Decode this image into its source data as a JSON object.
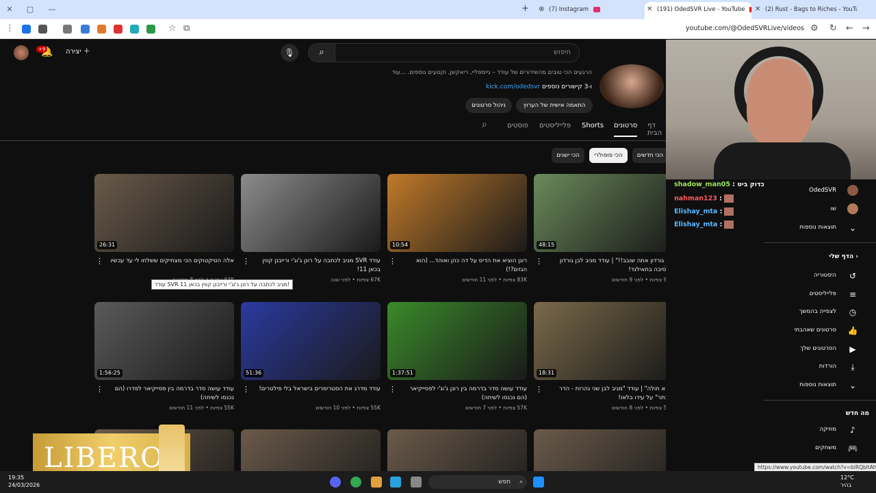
{
  "browser": {
    "tabs": [
      {
        "label": "(7) Instagram",
        "icon_color": "#e1306c"
      },
      {
        "label": "(191) OdedSVR Live - YouTube",
        "icon_color": "#ff0000"
      },
      {
        "label": "(2) Rust - Bags to Riches - YouTu",
        "icon_color": "#ff0000"
      }
    ],
    "url": "youtube.com/@OdedSVRLive/videos"
  },
  "header": {
    "notif_count": "+9",
    "create_label": "יצירה",
    "search_placeholder": "חיפוש"
  },
  "channel": {
    "description": "הרגעים הכי טובים מהשידורים של עודד – גיימפליי, ריאקשן, וקטעים נוספים. ...עוד",
    "link_text": "kick.com/odedsvr",
    "link_suffix": "ו-3 קישורים נוספים",
    "customize_button": "התאמה אישית של הערוץ",
    "manage_button": "ניהול סרטונים"
  },
  "channel_tabs": [
    "דף הבית",
    "סרטונים",
    "Shorts",
    "פלייליסטים",
    "פוסטים"
  ],
  "sort_chips": [
    "הכי חדשים",
    "הכי פופולרי",
    "הכי ישנים"
  ],
  "videos": [
    {
      "title": "\"בן גורדון אתה שובב!!\" | עודד מגיב לבן גורדון במסיבה בתאילנד!",
      "meta": "92K צפיות • לפני 9 חודשים",
      "duration": "48:15",
      "thumb": "#6a8a5a"
    },
    {
      "title": "רונן הוציא את הדיס על דה כהן ואוהד... (הוא הגזים?!)",
      "meta": "83K צפיות • לפני 11 חודשים",
      "duration": "10:54",
      "thumb": "#c07a2a"
    },
    {
      "title": "עודד SVR מגיב לכתבה על רונן ג'וג'י ורייבנן קווין בכאן 11!",
      "meta": "67K צפיות • לפני שנה",
      "duration": "",
      "thumb": "#8c8c8c"
    },
    {
      "title": "אלה הטיקטוקים הכי מצחיקים ששלחו לי עד עכשיו",
      "meta": "64K צפיות • לפני 8 חודשים",
      "duration": "26:31",
      "thumb": "#6a5a4a"
    },
    {
      "title": "\"הוא חולה\" | עודד \"מגיב לבן שני נהרות - הדר מוכתר\" על עידו בלאו!",
      "meta": "59K צפיות • לפני 8 חודשים",
      "duration": "18:31",
      "thumb": "#7a6a4a"
    },
    {
      "title": "עודד עושה סדר בדרמה בין רונן ג'וג'י לפסייקיאר (הם נכנסו לשיחה)",
      "meta": "57K צפיות • לפני 7 חודשים",
      "duration": "1:37:51",
      "thumb": "#3a8a2a"
    },
    {
      "title": "עודד מדרג את הסטרימרים בישראל בלי פילטרים!",
      "meta": "55K צפיות • לפני 10 חודשים",
      "duration": "51:36",
      "thumb": "#2a3aa0"
    },
    {
      "title": "עודד עושה סדר בדרמה בין פסייקיאר לפדרו (הם נכנסו לשיחה)",
      "meta": "55K צפיות • לפני 11 חודשים",
      "duration": "1:56:25",
      "thumb": "#5a5a5a"
    }
  ],
  "tooltip": "עודד SVR מגיב לכתבה על רונן ג'וג'י ורייבנן קווין בכאן 11!",
  "overlay": {
    "libero": "LIBERO"
  },
  "chat": [
    {
      "user": "shadow_man05",
      "text": ": תבדוק ביט",
      "color": "#9fe25a"
    },
    {
      "user": "nahman123",
      "text": ":",
      "color": "#ff5a5a"
    },
    {
      "user": "Elishay_mta",
      "text": ":",
      "color": "#5ab8ff"
    },
    {
      "user": "Elishay_mta",
      "text": ":",
      "color": "#5ab8ff"
    }
  ],
  "sidebar": {
    "subs": [
      {
        "label": "OdedSVR"
      },
      {
        "label": "שו"
      }
    ],
    "more1": "תוצאות נוספות",
    "you_header": "הדף שלי",
    "you_items": [
      {
        "label": "היסטוריה",
        "icon": "↺"
      },
      {
        "label": "פלייליסטים",
        "icon": "≡"
      },
      {
        "label": "לצפייה בהמשך",
        "icon": "◷"
      },
      {
        "label": "סרטונים שאהבתי",
        "icon": "👍"
      },
      {
        "label": "הסרטונים שלך",
        "icon": "▶"
      },
      {
        "label": "הורדות",
        "icon": "⤓"
      }
    ],
    "more2": "תוצאות נוספות",
    "explore_header": "מה חדש",
    "explore_items": [
      {
        "label": "מוזיקה",
        "icon": "♪"
      },
      {
        "label": "משחקים",
        "icon": "🎮"
      }
    ]
  },
  "status_url": "https://www.youtube.com/watch?v=biRQbltAtCI",
  "taskbar": {
    "time": "19:35",
    "date": "24/03/2026",
    "search": "חפש",
    "weather": "12°C",
    "weather_label": "בהיר"
  }
}
